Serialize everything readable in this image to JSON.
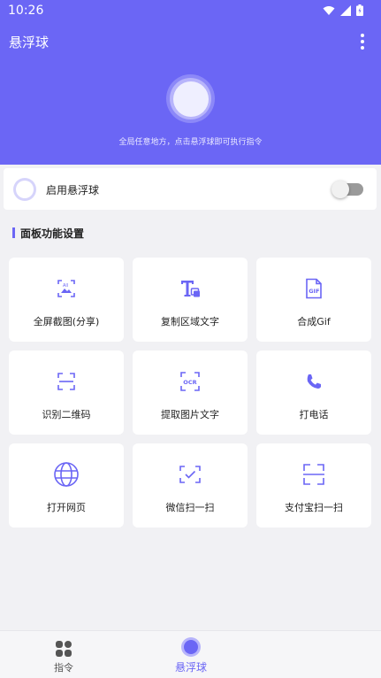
{
  "status": {
    "time": "10:26"
  },
  "header": {
    "title": "悬浮球",
    "hint": "全局任意地方，点击悬浮球即可执行指令"
  },
  "enable": {
    "label": "启用悬浮球",
    "enabled": false
  },
  "section": {
    "title": "面板功能设置"
  },
  "tiles": [
    {
      "label": "全屏截图(分享)",
      "icon": "screenshot-icon"
    },
    {
      "label": "复制区域文字",
      "icon": "text-copy-icon"
    },
    {
      "label": "合成Gif",
      "icon": "gif-icon"
    },
    {
      "label": "识别二维码",
      "icon": "qr-scan-icon"
    },
    {
      "label": "提取图片文字",
      "icon": "ocr-icon"
    },
    {
      "label": "打电话",
      "icon": "phone-icon"
    },
    {
      "label": "打开网页",
      "icon": "globe-icon"
    },
    {
      "label": "微信扫一扫",
      "icon": "wechat-scan-icon"
    },
    {
      "label": "支付宝扫一扫",
      "icon": "alipay-scan-icon"
    }
  ],
  "nav": {
    "commands_label": "指令",
    "ball_label": "悬浮球"
  },
  "colors": {
    "accent": "#6b66f5",
    "icon": "#6b66f5",
    "background": "#f1f1f4"
  }
}
